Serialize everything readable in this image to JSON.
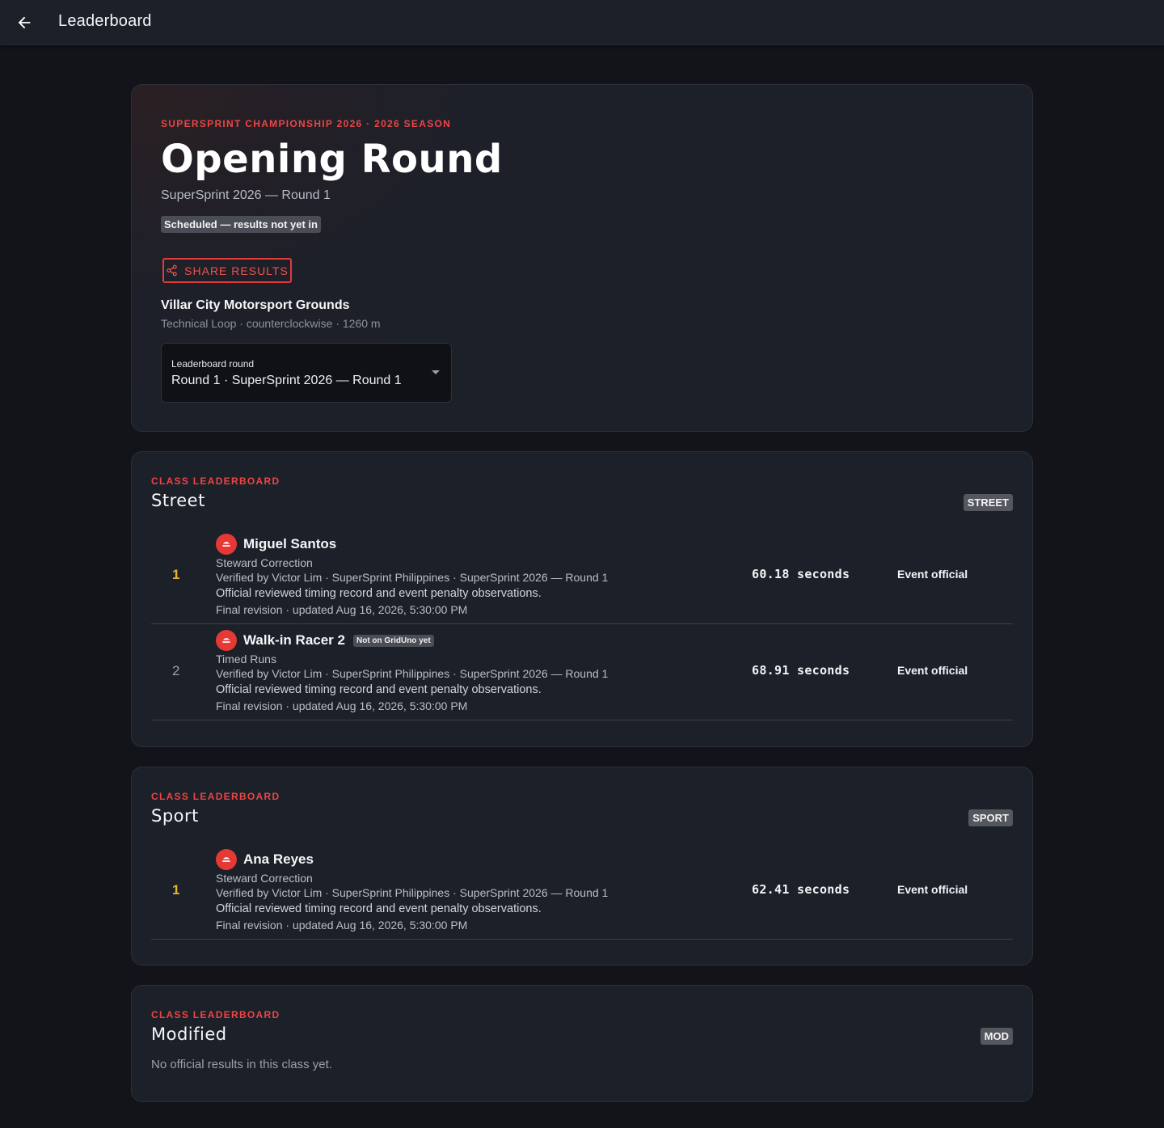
{
  "appbar": {
    "title": "Leaderboard"
  },
  "hero": {
    "eyebrow": "SUPERSPRINT CHAMPIONSHIP 2026 · 2026 SEASON",
    "title": "Opening Round",
    "subtitle": "SuperSprint 2026 — Round 1",
    "status": "Scheduled — results not yet in",
    "share_label": "SHARE RESULTS",
    "venue": {
      "name": "Villar City Motorsport Grounds",
      "detail": "Technical Loop · counterclockwise · 1260 m"
    },
    "round_select": {
      "label": "Leaderboard round",
      "value": "Round 1 · SuperSprint 2026 — Round 1"
    }
  },
  "classes": [
    {
      "eyebrow": "CLASS LEADERBOARD",
      "title": "Street",
      "badge": "STREET",
      "rows": [
        {
          "rank": "1",
          "name": "Miguel Santos",
          "tag": "",
          "type": "Steward Correction",
          "verified": "Verified by Victor Lim · SuperSprint Philippines · SuperSprint 2026 — Round 1",
          "note": "Official reviewed timing record and event penalty observations.",
          "revision": "Final revision · updated Aug 16, 2026, 5:30:00 PM",
          "time": "60.18 seconds",
          "source": "Event official"
        },
        {
          "rank": "2",
          "name": "Walk-in Racer 2",
          "tag": "Not on GridUno yet",
          "type": "Timed Runs",
          "verified": "Verified by Victor Lim · SuperSprint Philippines · SuperSprint 2026 — Round 1",
          "note": "Official reviewed timing record and event penalty observations.",
          "revision": "Final revision · updated Aug 16, 2026, 5:30:00 PM",
          "time": "68.91 seconds",
          "source": "Event official"
        }
      ]
    },
    {
      "eyebrow": "CLASS LEADERBOARD",
      "title": "Sport",
      "badge": "SPORT",
      "rows": [
        {
          "rank": "1",
          "name": "Ana Reyes",
          "tag": "",
          "type": "Steward Correction",
          "verified": "Verified by Victor Lim · SuperSprint Philippines · SuperSprint 2026 — Round 1",
          "note": "Official reviewed timing record and event penalty observations.",
          "revision": "Final revision · updated Aug 16, 2026, 5:30:00 PM",
          "time": "62.41 seconds",
          "source": "Event official"
        }
      ]
    },
    {
      "eyebrow": "CLASS LEADERBOARD",
      "title": "Modified",
      "badge": "MOD",
      "empty_text": "No official results in this class yet."
    }
  ],
  "colors": {
    "accent": "#ef4444",
    "gold": "#e8b230",
    "background": "#121419",
    "card": "#1c2029"
  }
}
